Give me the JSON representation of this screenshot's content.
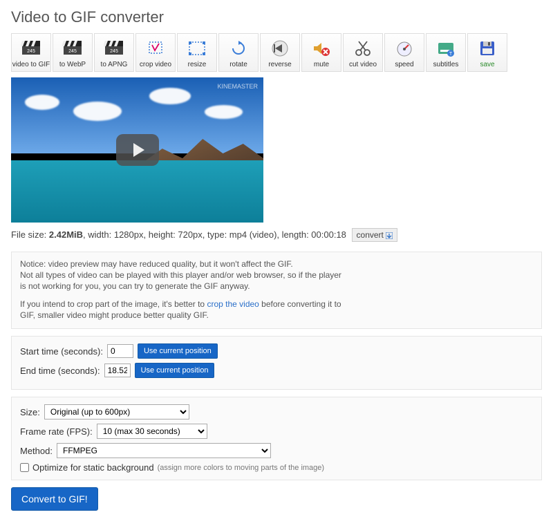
{
  "page_title": "Video to GIF converter",
  "toolbar": {
    "items": [
      {
        "label": "video to GIF",
        "icon": "clapper"
      },
      {
        "label": "to WebP",
        "icon": "clapper"
      },
      {
        "label": "to APNG",
        "icon": "clapper"
      },
      {
        "label": "crop video",
        "icon": "crop"
      },
      {
        "label": "resize",
        "icon": "resize"
      },
      {
        "label": "rotate",
        "icon": "rotate"
      },
      {
        "label": "reverse",
        "icon": "reverse"
      },
      {
        "label": "mute",
        "icon": "mute"
      },
      {
        "label": "cut video",
        "icon": "scissors"
      },
      {
        "label": "speed",
        "icon": "gauge"
      },
      {
        "label": "subtitles",
        "icon": "subtitles"
      },
      {
        "label": "save",
        "icon": "floppy"
      }
    ]
  },
  "video": {
    "watermark": "KINEMASTER"
  },
  "fileinfo": {
    "size_label": "File size: ",
    "size_value": "2.42MiB",
    "rest": ", width: 1280px, height: 720px, type: mp4 (video), length: 00:00:18",
    "convert_label": "convert"
  },
  "notice": {
    "l1": "Notice: video preview may have reduced quality, but it won't affect the GIF.",
    "l2": "Not all types of video can be played with this player and/or web browser, so if the player",
    "l3": "is not working for you, you can try to generate the GIF anyway.",
    "l4a": "If you intend to crop part of the image, it's better to ",
    "l4_link": "crop the video",
    "l4b": " before converting it to",
    "l5": "GIF, smaller video might produce better quality GIF."
  },
  "time": {
    "start_label": "Start time (seconds):",
    "start_value": "0",
    "end_label": "End time (seconds):",
    "end_value": "18.52",
    "use_current": "Use current position"
  },
  "options": {
    "size_label": "Size:",
    "size_selected": "Original (up to 600px)",
    "fps_label": "Frame rate (FPS):",
    "fps_selected": "10 (max 30 seconds)",
    "method_label": "Method:",
    "method_selected": "FFMPEG",
    "optimize_label": "Optimize for static background",
    "optimize_hint": "(assign more colors to moving parts of the image)"
  },
  "convert_button": "Convert to GIF!"
}
